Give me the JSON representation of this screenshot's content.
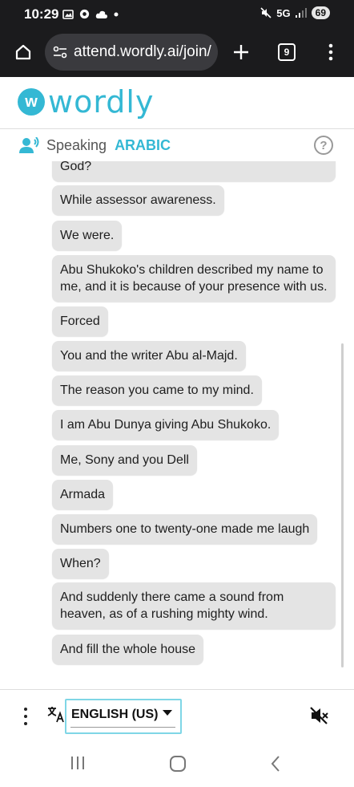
{
  "status_bar": {
    "time": "10:29",
    "network": "5G",
    "battery": "69",
    "icons": [
      "gallery-icon",
      "settings-gear-icon",
      "cloud-icon",
      "dot-icon",
      "mute-icon",
      "signal-icon"
    ]
  },
  "browser": {
    "url": "attend.wordly.ai/join/",
    "tab_count": "9",
    "icons": [
      "home-icon",
      "site-settings-icon",
      "new-tab-icon",
      "tabs-icon",
      "menu-icon"
    ]
  },
  "brand": {
    "logo_letter": "w",
    "name": "wordly",
    "color": "#34b8d4"
  },
  "speaking": {
    "label": "Speaking",
    "language": "ARABIC",
    "help": "?"
  },
  "messages": [
    "God?",
    "While assessor awareness.",
    "We were.",
    "Abu Shukoko's children described my name to me, and it is because of your presence with us.",
    "Forced",
    "You and the writer Abu al-Majd.",
    "The reason you came to my mind.",
    "I am Abu Dunya giving Abu Shukoko.",
    "Me, Sony and you Dell",
    "Armada",
    "Numbers one to twenty-one made me laugh",
    "When?",
    "And suddenly there came a sound from heaven, as of a rushing mighty wind.",
    "And fill the whole house"
  ],
  "bottom_bar": {
    "language_select": "ENGLISH (US)"
  },
  "colors": {
    "accent": "#34b8d4",
    "bubble": "#e4e4e4",
    "browser_chrome": "#1b1b1d"
  }
}
